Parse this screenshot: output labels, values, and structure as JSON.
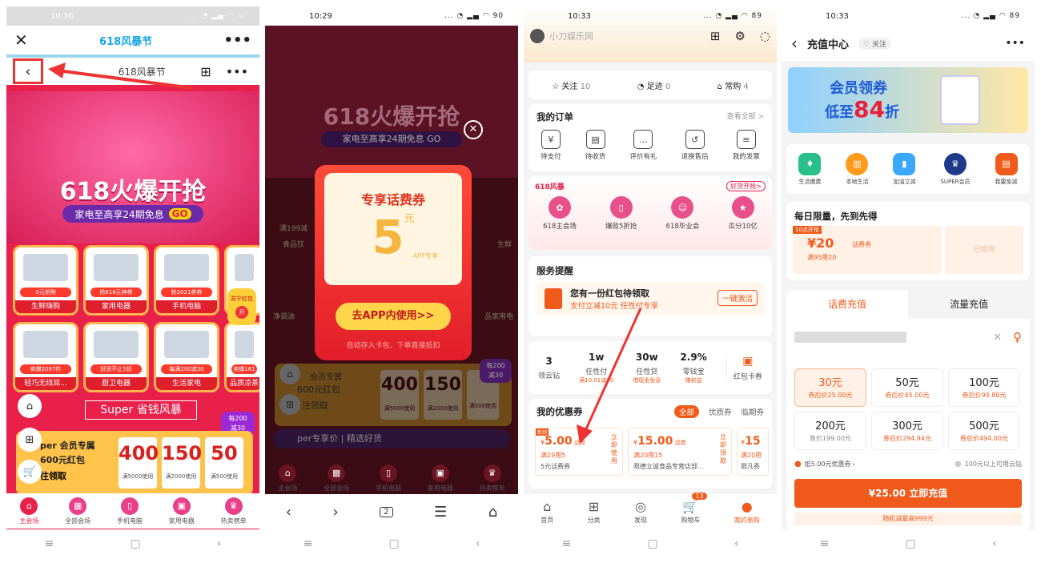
{
  "p1": {
    "time": "10:36",
    "title": "618风暴节",
    "subtitle": "618风暴节",
    "banner_title": "618火爆开抢",
    "banner_sub": "家电至高享24期免息",
    "banner_go": "GO",
    "tiles": [
      {
        "tag": "0元抢购",
        "label": "生鲜嗨购"
      },
      {
        "tag": "抢618元神券",
        "label": "家用电器"
      },
      {
        "tag": "抢2021券券",
        "label": "手机电脑"
      },
      {
        "tag": "卖爆2087件",
        "label": "轻巧无线耳..."
      },
      {
        "tag": "好货不止5折",
        "label": "厨卫电器"
      },
      {
        "tag": "每满200减30",
        "label": "生活家电"
      },
      {
        "tag": "卖爆161",
        "label": "品质凉茶"
      }
    ],
    "side_tag": "苏宁红包",
    "side_tag2": "开",
    "super_title": "Super 省钱风暴",
    "badge_top": "每200",
    "badge_bot": "减30",
    "vip_title": "per 会员专属",
    "vip_sub": "600元红包",
    "vip_btn": "往领取",
    "coupons": [
      {
        "amt": "400",
        "cond": "满5000使用"
      },
      {
        "amt": "150",
        "cond": "满2000使用"
      },
      {
        "amt": "50",
        "cond": "满500使用"
      }
    ],
    "tabs": [
      "主会场",
      "全部会场",
      "手机电脑",
      "家用电器",
      "热卖榜单"
    ]
  },
  "p2": {
    "time": "10:29",
    "battery": "90",
    "banner_title": "618火爆开抢",
    "banner_sub": "家电至高享24期免息",
    "banner_go": "GO",
    "popup_title": "专享话费券",
    "popup_amt": "5",
    "popup_unit": "元",
    "popup_app": "APP专享",
    "popup_btn": "去APP内使用>>",
    "popup_note": "自动存入卡包，下单直接抵扣",
    "vip_title": "会员专属",
    "vip_sub": "600元红包",
    "vip_btn": "注领取",
    "coupons": [
      {
        "amt": "400",
        "cond": "满5000使用"
      },
      {
        "amt": "150",
        "cond": "满2000使用"
      },
      {
        "amt": "",
        "cond": "满500使用"
      }
    ],
    "badge_top": "每200",
    "badge_bot": "减30",
    "super_row": "per专享价",
    "super_row2": "精选好货",
    "tabs": [
      "主会场",
      "全部会场",
      "手机电脑",
      "家用电器",
      "热卖榜单"
    ],
    "left_items": [
      "满199减",
      "食品饮",
      "净调油",
      "品家用"
    ],
    "right_items": [
      "生鲜",
      "品家用电"
    ],
    "page_count": "2"
  },
  "p3": {
    "time": "10:33",
    "battery": "89",
    "user": "小刀娱乐网",
    "follow": "关注",
    "follow_n": "10",
    "track": "足迹",
    "track_n": "0",
    "buy": "常购",
    "buy_n": "4",
    "orders_title": "我的订单",
    "orders_all": "查看全部 >",
    "orders": [
      "待支付",
      "待收货",
      "评价有礼",
      "退换售后",
      "我的发票"
    ],
    "promo_tag": "618风暴",
    "promo_badge": "好货开抢>",
    "promo": [
      "618主会场",
      "爆款5折抢",
      "618毕业会",
      "瓜分10亿"
    ],
    "svc_title": "服务提醒",
    "svc_main": "您有一份红包待领取",
    "svc_sub": "支付立减10元 任性付专享",
    "svc_btn": "一键激活",
    "stats": [
      {
        "v": "3",
        "l": "领云钻",
        "s": ""
      },
      {
        "v": "1w",
        "l": "任性付",
        "s": "满10.01减10"
      },
      {
        "v": "30w",
        "l": "任性贷",
        "s": "借现金免息"
      },
      {
        "v": "2.9%",
        "l": "零钱宝",
        "s": "赚权益"
      }
    ],
    "stats_card": "红包卡券",
    "coupon_title": "我的优惠券",
    "coupon_tabs": [
      "全部",
      "优质券",
      "临期券"
    ],
    "coupons": [
      {
        "new": "新到",
        "amt": "5.00",
        "unit": "話券",
        "cond": "满29用5",
        "desc": "5元话费券",
        "btn": "立即使用"
      },
      {
        "amt": "15.00",
        "unit": "話券",
        "cond": "满20用15",
        "desc": "限德立诚食品专营店部...",
        "btn": "立即领取"
      },
      {
        "amt": "15",
        "unit": "",
        "cond": "满20用",
        "desc": "限凡秀"
      }
    ],
    "tabs": [
      "首页",
      "分类",
      "发现",
      "购物车",
      "我的易购"
    ],
    "cart_badge": "13"
  },
  "p4": {
    "time": "10:33",
    "battery": "89",
    "title": "充值中心",
    "follow": "关注",
    "banner_t1": "会员领券",
    "banner_t2": "低至",
    "banner_num": "84",
    "banner_t3": "折",
    "icons": [
      "生活缴费",
      "本地生活",
      "加油立减",
      "SUPER会员",
      "我要免减"
    ],
    "limit_title": "每日限量，先到先得",
    "coupon_time": "10点开抢",
    "coupon_amt": "¥20",
    "coupon_name": "话费券",
    "coupon_cond": "满95用20",
    "coupon_taken": "已抢完",
    "tab_a": "话费充值",
    "tab_b": "流量充值",
    "packs": [
      {
        "a": "30元",
        "b": "券后价25.00元"
      },
      {
        "a": "50元",
        "b": "券后价45.00元"
      },
      {
        "a": "100元",
        "b": "券后价94.80元"
      },
      {
        "a": "200元",
        "b": "售价199.00元"
      },
      {
        "a": "300元",
        "b": "券后价294.94元"
      },
      {
        "a": "500元",
        "b": "券后价494.00元"
      }
    ],
    "discount": "抵5.00元优惠券",
    "cloud": "100元以上可用云钻",
    "pay_btn": "¥25.00 立即充值",
    "random": "随机减最高999元"
  },
  "colors": {
    "orange": "#f05a1a",
    "red": "#e01f2d",
    "brand": "#19a6e6"
  }
}
